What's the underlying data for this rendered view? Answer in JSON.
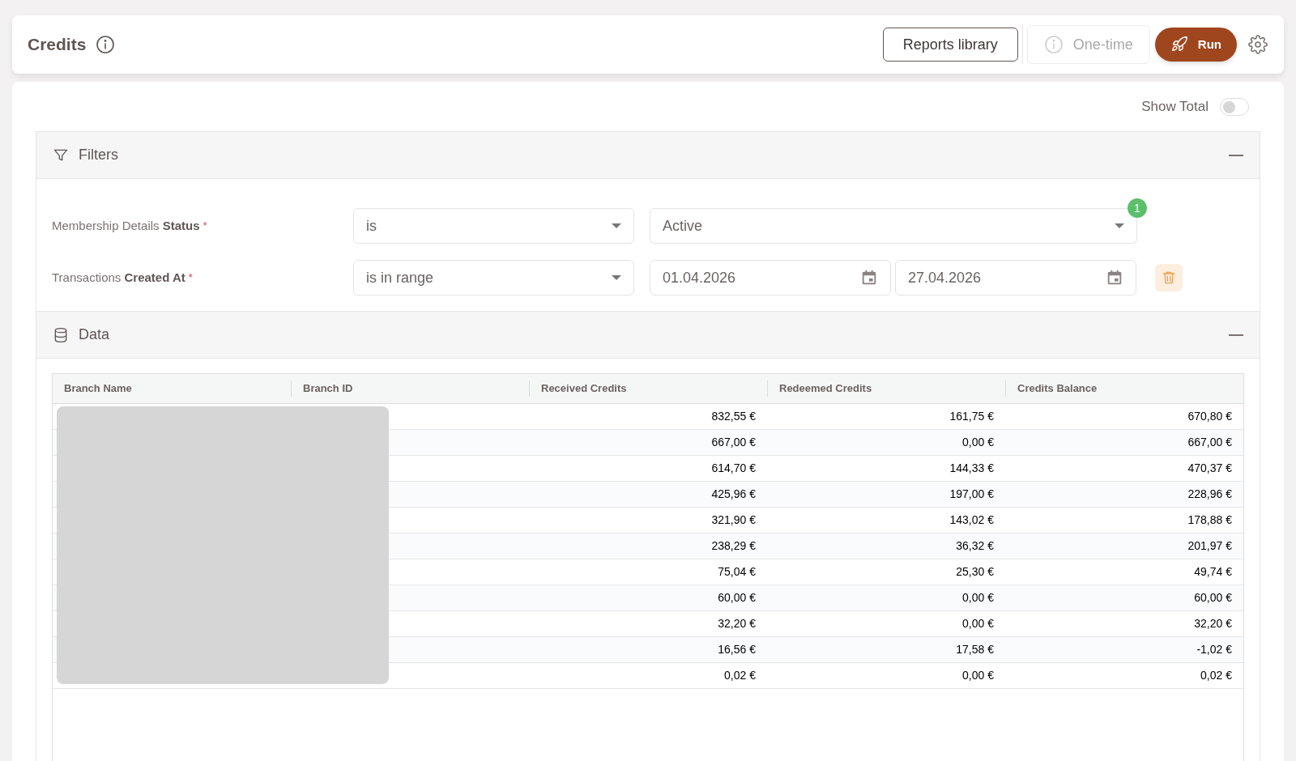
{
  "header": {
    "title": "Credits",
    "buttons": [
      {
        "label": "Reports library",
        "kind": "outline"
      },
      {
        "label": "One-time",
        "kind": "disabled"
      },
      {
        "label": "Run",
        "kind": "primary"
      }
    ]
  },
  "show_total": {
    "label": "Show Total",
    "on": false
  },
  "filters": {
    "title": "Filters",
    "expanded": true,
    "rows": [
      {
        "kind": "select",
        "label": "Membership Details **Status**",
        "required_mark": "*",
        "operator": "is",
        "value": "Active",
        "badge": "1"
      },
      {
        "kind": "date_range",
        "label": "Transactions **Created At**",
        "required_mark": "*",
        "operator": "is in range",
        "from": "01.04.2026",
        "to": "27.04.2026"
      }
    ]
  },
  "data": {
    "title": "Data",
    "expanded": true,
    "table": {
      "columns": [
        "Branch Name",
        "Branch ID",
        "Received Credits",
        "Redeemed Credits",
        "Credits Balance"
      ],
      "rows": [
        [
          "832,55 €",
          "161,75 €",
          "670,80 €"
        ],
        [
          "667,00 €",
          "0,00 €",
          "667,00 €"
        ],
        [
          "614,70 €",
          "144,33 €",
          "470,37 €"
        ],
        [
          "425,96 €",
          "197,00 €",
          "228,96 €"
        ],
        [
          "321,90 €",
          "143,02 €",
          "178,88 €"
        ],
        [
          "238,29 €",
          "36,32 €",
          "201,97 €"
        ],
        [
          "75,04 €",
          "25,30 €",
          "49,74 €"
        ],
        [
          "60,00 €",
          "0,00 €",
          "60,00 €"
        ],
        [
          "32,20 €",
          "0,00 €",
          "32,20 €"
        ],
        [
          "16,56 €",
          "17,58 €",
          "-1,02 €"
        ],
        [
          "0,02 €",
          "0,00 €",
          "0,02 €"
        ]
      ]
    }
  }
}
